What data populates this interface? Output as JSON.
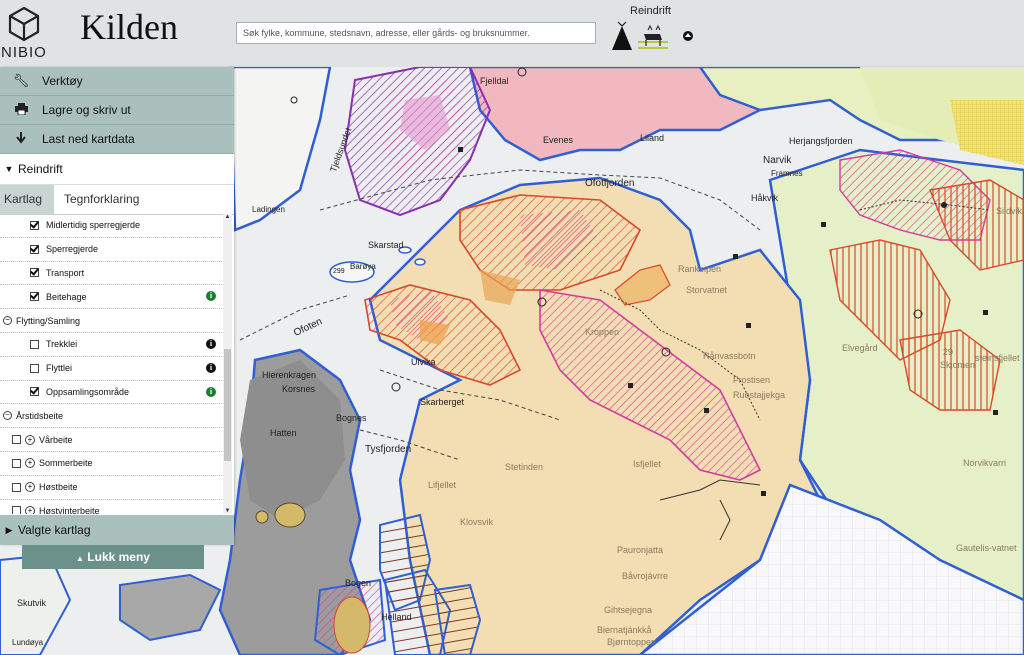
{
  "header": {
    "logo_text": "NIBIO",
    "app_title": "Kilden",
    "search_placeholder": "Søk fylke, kommune, stedsnavn, adresse, eller gårds- og bruksnummer.",
    "theme_label": "Reindrift",
    "theme_icon": "reindeer-herding-icon"
  },
  "tools": [
    {
      "label": "Verktøy",
      "icon": "wrench-icon"
    },
    {
      "label": "Lagre og skriv ut",
      "icon": "printer-icon"
    },
    {
      "label": "Last ned kartdata",
      "icon": "download-icon"
    }
  ],
  "section": {
    "title": "Reindrift"
  },
  "tabs": [
    {
      "label": "Kartlag",
      "active": true
    },
    {
      "label": "Tegnforklaring",
      "active": false
    }
  ],
  "layers": {
    "midlertidig": "Midlertidig sperregjerde",
    "sperregjerde": "Sperregjerde",
    "transport": "Transport",
    "beitehage": "Beitehage",
    "flytting_group": "Flytting/Samling",
    "trekklei": "Trekklei",
    "flyttlei": "Flyttlei",
    "oppsamling": "Oppsamlingsområde",
    "arstid_group": "Årstidsbeite",
    "varbeite": "Vårbeite",
    "sommerbeite": "Sommerbeite",
    "hostbeite": "Høstbeite",
    "hostvinterbeite": "Høstvinterbeite"
  },
  "valgte_kartlag": "Valgte kartlag",
  "lukk_meny": "Lukk meny",
  "map_labels": {
    "fjelldal": "Fjelldal",
    "evenes": "Evenes",
    "liland": "Liland",
    "tjeldsundet": "Tjeldsundet",
    "narvik": "Narvik",
    "framnes": "Framnes",
    "herjangsfjorden": "Herjangsfjorden",
    "haakvik": "Håkvik",
    "ofotfjorden": "Ofotfjorden",
    "skarstad": "Skarstad",
    "baroya": "Barøya",
    "n299a": "299",
    "ofoten": "Ofoten",
    "ulvika": "Ulvika",
    "hierenkragen": "Hierenkragen",
    "korsnes": "Korsnes",
    "skarberget": "Skarberget",
    "bognes": "Bognes",
    "tysfjorden": "Tysfjorden",
    "hatten": "Hatten",
    "kroppen": "Kroppen",
    "rankeipen": "Rankeipen",
    "storvatnet": "Storvatnet",
    "ranvassbotn": "Rånvassbotn",
    "frostisen": "Frostisen",
    "ruostajjekga": "Ruostajjekga",
    "skjomen": "Skjomen",
    "n29": "29",
    "elvegard": "Elvegård",
    "sildvik": "Sildvik",
    "isfjellet": "Isfjellet",
    "stetinden": "Stetinden",
    "lifjellet": "Lifjellet",
    "klovsvik": "Klovsvik",
    "pauronjatta": "Pauronjatta",
    "bavrojavrre": "Båvrojávrre",
    "gihtsejegna": "Gihtsejegna",
    "biernatjankka": "Biernatjánkkå",
    "bjorntoppen": "Bjørntoppen",
    "skutvik": "Skutvik",
    "lundoya": "Lundøya",
    "helland": "Helland",
    "bogen": "Bogen",
    "norvikvarri": "Norvikvarri",
    "gautelis": "Gautelis-vatnet",
    "steinsfjellet": "steinsfjellet",
    "laddingen": "Ladingen"
  }
}
